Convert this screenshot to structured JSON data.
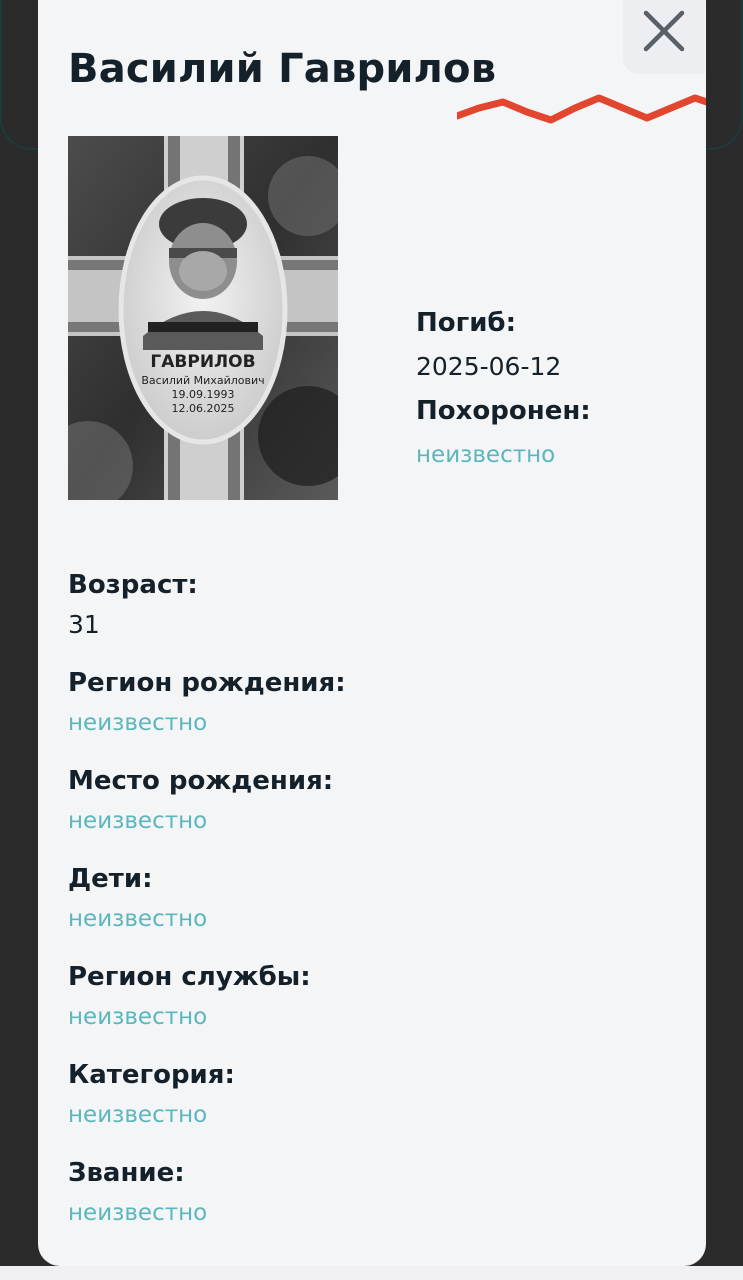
{
  "title": "Василий Гаврилов",
  "colors": {
    "accent_zigzag": "#e2462f",
    "link": "#5bb7bd",
    "text": "#14202a",
    "modal_bg": "#f4f5f7"
  },
  "close_icon": "close-icon",
  "photo": {
    "plaque_name": "ГАВРИЛОВ",
    "plaque_patronymic": "Василий Михайлович",
    "plaque_birth": "19.09.1993",
    "plaque_death": "12.06.2025"
  },
  "side_info": {
    "died_label": "Погиб:",
    "died_value": "2025-06-12",
    "buried_label": "Похоронен:",
    "buried_value": "неизвестно"
  },
  "fields": [
    {
      "label": "Возраст:",
      "value": "31"
    },
    {
      "label": "Регион рождения:",
      "value": "неизвестно"
    },
    {
      "label": "Место рождения:",
      "value": "неизвестно"
    },
    {
      "label": "Дети:",
      "value": "неизвестно"
    },
    {
      "label": "Регион службы:",
      "value": "неизвестно"
    },
    {
      "label": "Категория:",
      "value": "неизвестно"
    },
    {
      "label": "Звание:",
      "value": "неизвестно"
    }
  ]
}
